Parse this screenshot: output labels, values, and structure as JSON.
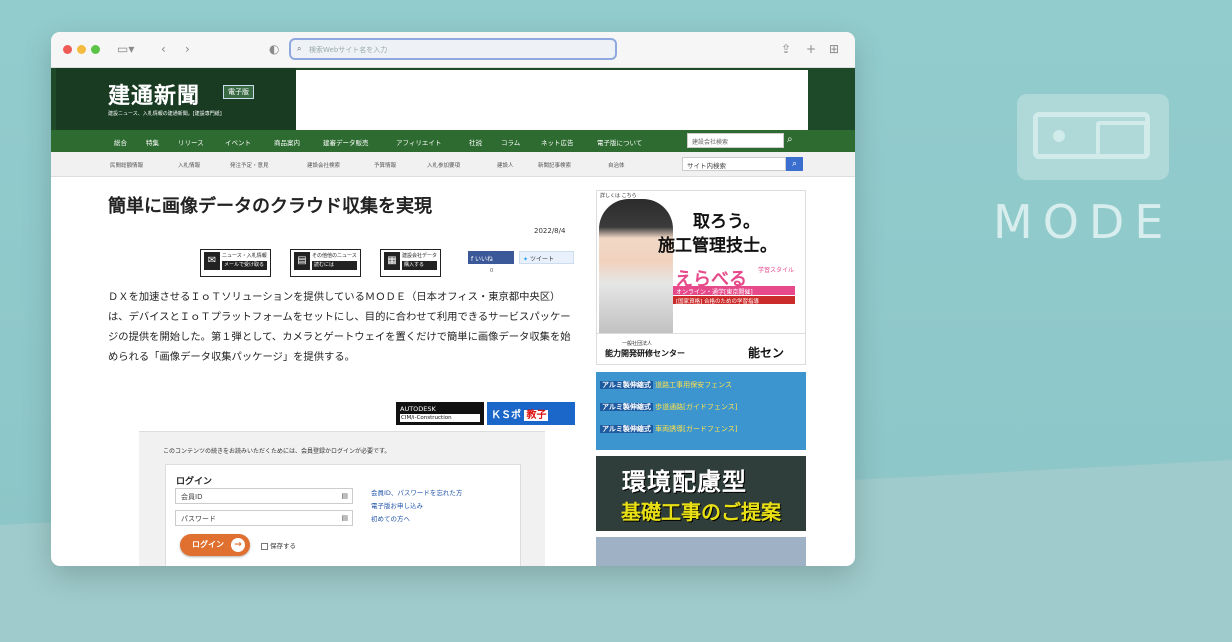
{
  "desktop": {
    "brand_text": "MODE"
  },
  "browser": {
    "address_placeholder": "検索Webサイト名を入力",
    "toolbar_icons": [
      "sidebar-icon",
      "back-icon",
      "forward-icon",
      "shield-icon",
      "share-icon",
      "new-tab-icon",
      "tab-overview-icon"
    ]
  },
  "site": {
    "title": "建通新聞",
    "edition_badge": "電子版",
    "subtitle": "建設ニュース、入札情報の建通新聞。[建設専門紙]",
    "global_nav": [
      "総合",
      "特集",
      "リリース",
      "イベント",
      "商品案内",
      "建審データ販売",
      "アフィリエイト",
      "社説",
      "コラム",
      "ネット広告",
      "電子版について"
    ],
    "company_search_placeholder": "建設会社検索",
    "sub_nav": [
      "民間総額情報",
      "入札情報",
      "発注予定・意見",
      "建設会社検索",
      "予算情報",
      "入札参加要項",
      "建設人",
      "新聞記事検索",
      "自治体"
    ],
    "site_search_placeholder": "サイト内検索"
  },
  "article": {
    "headline": "簡単に画像データのクラウド収集を実現",
    "date": "2022/8/4",
    "share_buttons": [
      {
        "line1": "ニュース・入札情報",
        "line2": "メールで受け取る"
      },
      {
        "line1": "その他他のニュース",
        "line2": "読むには"
      },
      {
        "line1": "建設会社データ",
        "line2": "購入する"
      }
    ],
    "facebook_label": "いいね",
    "facebook_count": "0",
    "tweet_label": "ツイート",
    "body": "ＤＸを加速させるＩｏＴソリューションを提供しているＭＯＤＥ（日本オフィス・東京都中央区）は、デバイスとＩｏＴプラットフォームをセットにし、目的に合わせて利用できるサービスパッケージの提供を開始した。第１弾として、カメラとゲートウェイを置くだけで簡単に画像データ収集を始められる「画像データ収集パッケージ」を提供する。",
    "ad_autodesk_title": "AUTODESK",
    "ad_autodesk_sub": "CIM/i-Construction",
    "ad_kyasupo": "ＫＳポ",
    "ad_kyasupo_highlight": "教子"
  },
  "login": {
    "notice": "このコンテンツの続きをお読みいただくためには、会員登録かログインが必要です。",
    "title": "ログイン",
    "member_id_placeholder": "会員ID",
    "password_placeholder": "パスワード",
    "links": [
      "会員ID、パスワードを忘れた方",
      "電子版お申し込み",
      "初めての方へ"
    ],
    "login_button": "ログイン",
    "remember_label": "保存する"
  },
  "sidebar_ads": {
    "ad1_small": "詳しくは こちら",
    "ad1_line1": "取ろう。",
    "ad1_line2": "施工管理技士。",
    "ad1_brand": "えらべる",
    "ad1_brand_tag": "学習スタイル",
    "ad1_stripe": "オンライン・通学[東京開催]",
    "ad1_red": "[国家資格] 合格のための学習指導",
    "ad1_org_small": "一般社団法人",
    "ad1_org": "能力開発研修センター",
    "ad1_logo": "能セン",
    "ad2_rows": [
      {
        "tag": "アルミ製伸縮式",
        "text": "道路工事用保安フェンス"
      },
      {
        "tag": "アルミ製伸縮式",
        "text": "歩道通路[ガイドフェンス]"
      },
      {
        "tag": "アルミ製伸縮式",
        "text": "車両誘導[ガードフェンス]"
      }
    ],
    "ad3_line1": "環境配慮型",
    "ad3_line2": "基礎工事のご提案"
  }
}
